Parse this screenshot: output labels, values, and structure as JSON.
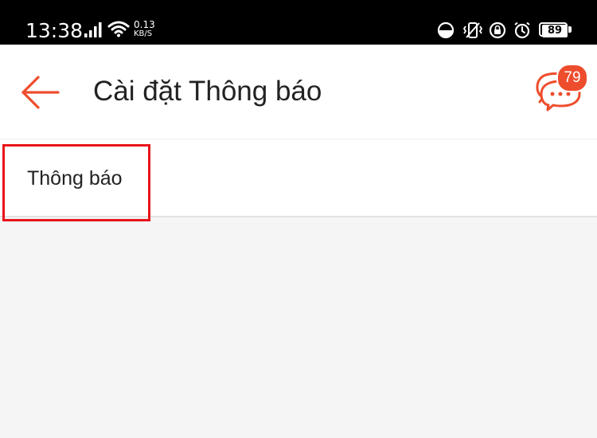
{
  "status_bar": {
    "time": "13:38",
    "net_speed_value": "0.13",
    "net_speed_unit": "KB/S",
    "battery_level": "89",
    "icons": [
      "signal-icon",
      "wifi-icon",
      "data-saver-icon",
      "vibrate-icon",
      "lock-rotation-icon",
      "alarm-icon",
      "battery-icon"
    ]
  },
  "header": {
    "title": "Cài đặt Thông báo",
    "back_icon": "arrow-left-icon",
    "chat_icon": "chat-bubbles-icon",
    "chat_badge_count": "79"
  },
  "settings": {
    "items": [
      {
        "label": "Thông báo"
      }
    ]
  },
  "colors": {
    "accent": "#ee4d2d",
    "highlight_box": "#e8141a",
    "status_bar_bg": "#000000",
    "page_bg": "#f5f5f5",
    "text": "#222222"
  }
}
